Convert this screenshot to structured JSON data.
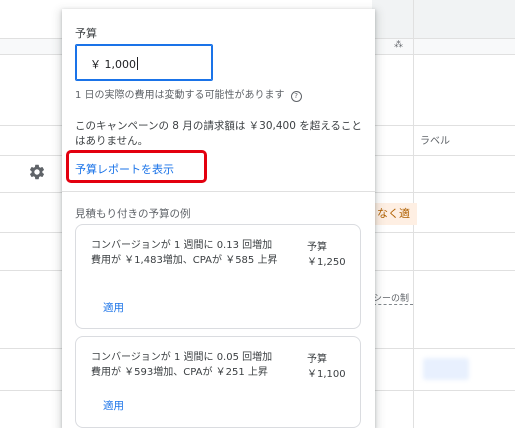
{
  "background": {
    "column_label": "ラベル",
    "warning_fragment": "なく適",
    "small_fragment": "シーの制",
    "settings_icon": "gear-icon"
  },
  "popup": {
    "budget_label": "予算",
    "budget_value": "￥ 1,000",
    "helper_text": "1 日の実際の費用は変動する可能性があります",
    "help_icon": "help-circle-icon",
    "billing_text": "このキャンペーンの 8 月の請求額は ￥30,400 を超えることはありません。",
    "report_link": "予算レポートを表示",
    "examples_title": "見積もり付きの予算の例",
    "examples": [
      {
        "description": "コンバージョンが 1 週間に 0.13 回増加　費用が ￥1,483増加、CPAが ￥585 上昇",
        "budget_label": "予算",
        "budget_value": "￥1,250",
        "apply_label": "適用"
      },
      {
        "description": "コンバージョンが 1 週間に 0.05 回増加　費用が ￥593増加、CPAが ￥251 上昇",
        "budget_label": "予算",
        "budget_value": "￥1,100",
        "apply_label": "適用"
      }
    ]
  },
  "colors": {
    "accent": "#1a73e8",
    "highlight": "#e3000f"
  }
}
